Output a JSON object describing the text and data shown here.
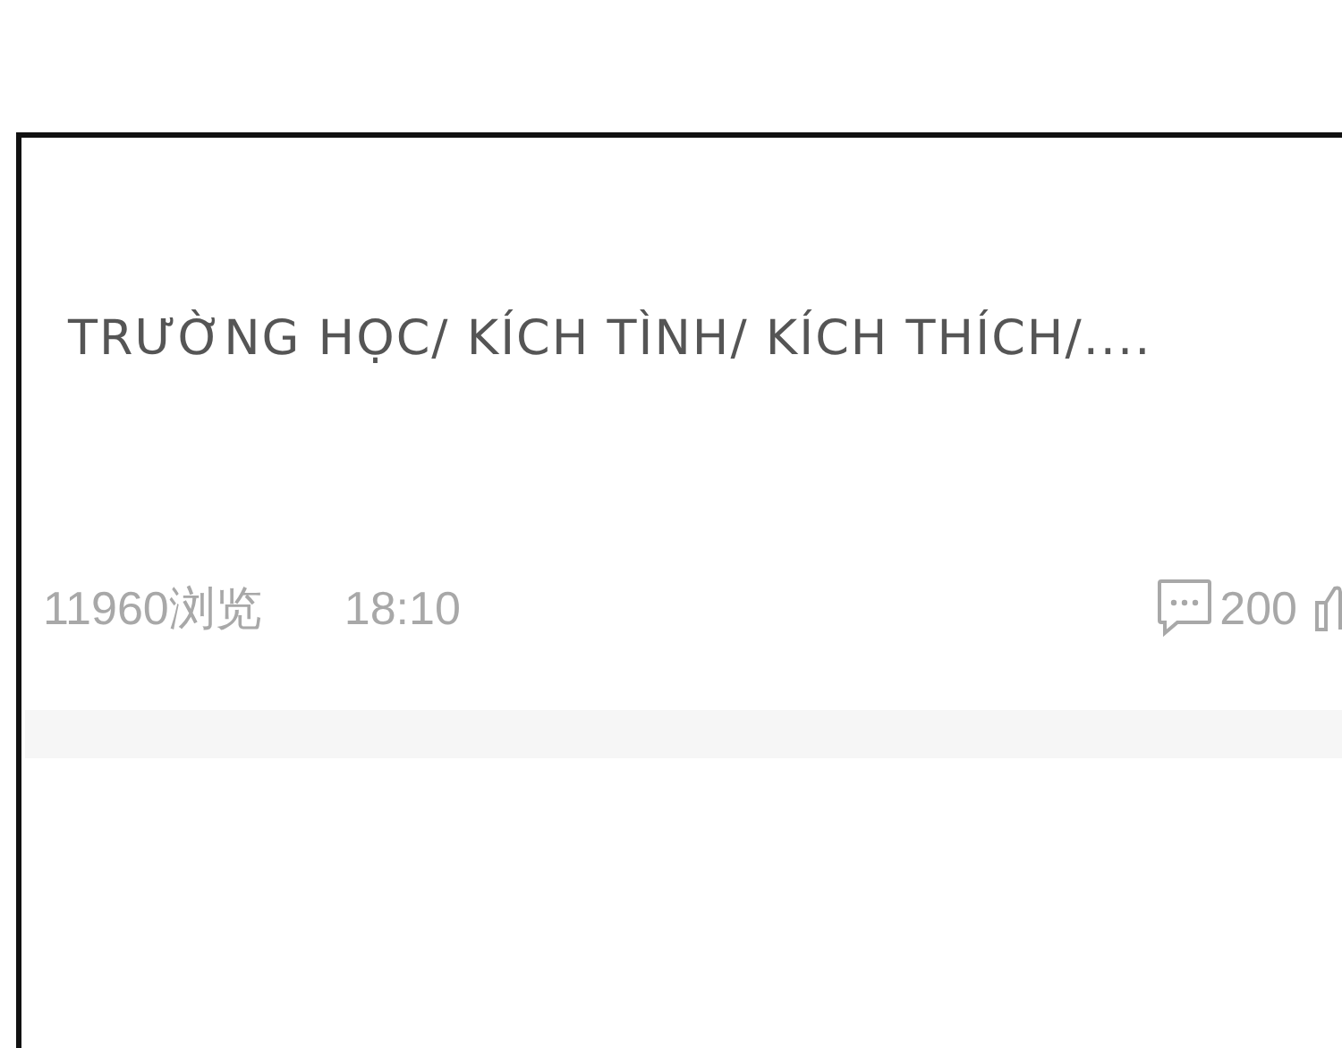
{
  "post": {
    "title": "TRƯỜNG HỌC/ KÍCH TÌNH/ KÍCH THÍCH/....",
    "views": "11960浏览",
    "time": "18:10",
    "comments": "200"
  }
}
